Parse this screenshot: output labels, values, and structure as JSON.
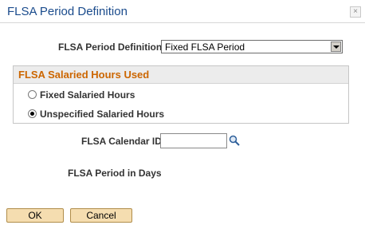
{
  "window": {
    "title": "FLSA Period Definition",
    "close_glyph": "×"
  },
  "form": {
    "period_definition_label": "FLSA Period Definition",
    "period_definition_value": "Fixed FLSA Period",
    "salaried_hours": {
      "title": "FLSA Salaried Hours Used",
      "options": [
        {
          "label": "Fixed Salaried Hours",
          "checked": false
        },
        {
          "label": "Unspecified Salaried Hours",
          "checked": true
        }
      ]
    },
    "calendar_id_label": "FLSA Calendar ID",
    "calendar_id_value": "",
    "period_in_days_label": "FLSA Period in Days",
    "period_in_days_value": ""
  },
  "buttons": {
    "ok": "OK",
    "cancel": "Cancel"
  },
  "colors": {
    "title": "#1a4b8c",
    "group_title": "#cc6600",
    "button_fill": "#f5ddb0"
  },
  "icons": {
    "close": "close-icon",
    "lookup": "search-icon",
    "dropdown": "chevron-down-icon"
  }
}
